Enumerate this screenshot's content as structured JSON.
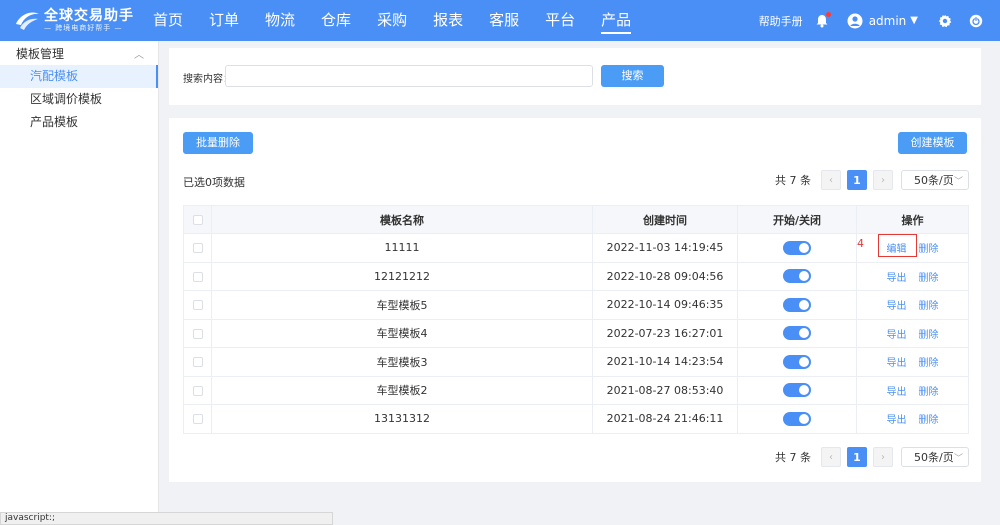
{
  "brand": {
    "title": "全球交易助手",
    "subtitle": "— 跨境电商好帮手 —"
  },
  "nav": {
    "items": [
      "首页",
      "订单",
      "物流",
      "仓库",
      "采购",
      "报表",
      "客服",
      "平台",
      "产品"
    ],
    "active_index": 8
  },
  "header": {
    "help_label": "帮助手册",
    "user_name": "admin"
  },
  "sidebar": {
    "group_title": "模板管理",
    "items": [
      "汽配模板",
      "区域调价模板",
      "产品模板"
    ],
    "active_index": 0
  },
  "search": {
    "label": "搜索内容：",
    "value": "",
    "placeholder": "",
    "button_label": "搜索"
  },
  "toolbar": {
    "batch_delete_label": "批量删除",
    "create_label": "创建模板",
    "selected_info": "已选0项数据"
  },
  "pagination": {
    "total_text": "共 7 条",
    "current_page": "1",
    "page_size": "50条/页"
  },
  "table": {
    "headers": [
      "模板名称",
      "创建时间",
      "开始/关闭",
      "操作"
    ],
    "rows": [
      {
        "name": "11111",
        "created": "2022-11-03 14:19:45",
        "enabled": true,
        "actions": [
          "编辑",
          "删除"
        ]
      },
      {
        "name": "12121212",
        "created": "2022-10-28 09:04:56",
        "enabled": true,
        "actions": [
          "导出",
          "删除"
        ]
      },
      {
        "name": "车型模板5",
        "created": "2022-10-14 09:46:35",
        "enabled": true,
        "actions": [
          "导出",
          "删除"
        ]
      },
      {
        "name": "车型模板4",
        "created": "2022-07-23 16:27:01",
        "enabled": true,
        "actions": [
          "导出",
          "删除"
        ]
      },
      {
        "name": "车型模板3",
        "created": "2021-10-14 14:23:54",
        "enabled": true,
        "actions": [
          "导出",
          "删除"
        ]
      },
      {
        "name": "车型模板2",
        "created": "2021-08-27 08:53:40",
        "enabled": true,
        "actions": [
          "导出",
          "删除"
        ]
      },
      {
        "name": "13131312",
        "created": "2021-08-24 21:46:11",
        "enabled": true,
        "actions": [
          "导出",
          "删除"
        ]
      }
    ]
  },
  "annotation": {
    "marker": "4"
  },
  "statusbar": {
    "text": "javascript:;"
  },
  "colors": {
    "primary": "#4a8ff5",
    "highlight": "#e53935"
  },
  "icons": [
    "logo-icon",
    "bell-icon",
    "user-avatar-icon",
    "caret-down-icon",
    "gear-icon",
    "power-icon",
    "chevron-up-icon",
    "chevron-left-icon",
    "chevron-right-icon",
    "chevron-down-icon"
  ]
}
